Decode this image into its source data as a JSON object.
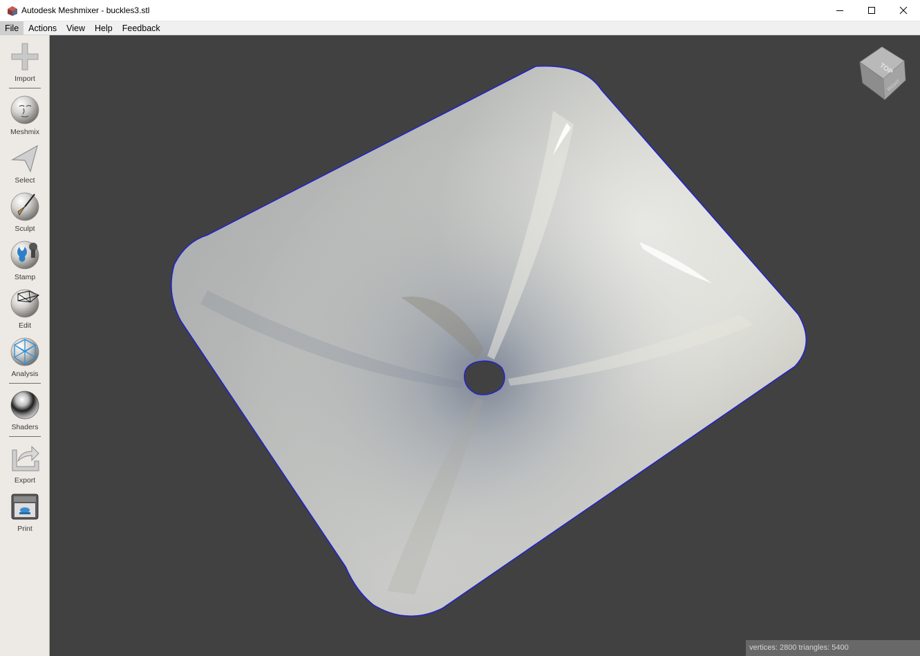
{
  "window": {
    "title": "Autodesk Meshmixer - buckles3.stl",
    "controls": {
      "minimize_icon": "minimize-icon",
      "maximize_icon": "maximize-icon",
      "close_icon": "close-icon"
    }
  },
  "menu": {
    "items": [
      {
        "label": "File",
        "active": true
      },
      {
        "label": "Actions",
        "active": false
      },
      {
        "label": "View",
        "active": false
      },
      {
        "label": "Help",
        "active": false
      },
      {
        "label": "Feedback",
        "active": false
      }
    ]
  },
  "toolbar": {
    "tools": [
      {
        "label": "Import",
        "icon": "plus-icon"
      },
      {
        "label": "Meshmix",
        "icon": "meshmix-face-icon"
      },
      {
        "label": "Select",
        "icon": "arrow-pointer-icon"
      },
      {
        "label": "Sculpt",
        "icon": "brush-sphere-icon"
      },
      {
        "label": "Stamp",
        "icon": "stamp-sphere-icon"
      },
      {
        "label": "Edit",
        "icon": "edit-mesh-sphere-icon"
      },
      {
        "label": "Analysis",
        "icon": "analysis-sphere-icon"
      },
      {
        "label": "Shaders",
        "icon": "chrome-sphere-icon"
      },
      {
        "label": "Export",
        "icon": "export-arrow-icon"
      },
      {
        "label": "Print",
        "icon": "printer-icon"
      }
    ]
  },
  "viewport": {
    "background": "#414141",
    "mesh_boundary_color": "#2222cc",
    "view_cube": {
      "faces": [
        "TOP",
        "RIGHT"
      ]
    }
  },
  "status": {
    "text": "vertices: 2800 triangles: 5400"
  }
}
